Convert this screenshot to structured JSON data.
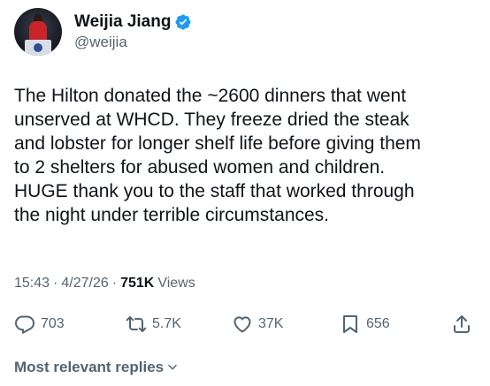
{
  "author": {
    "display_name": "Weijia Jiang",
    "handle": "@weijia",
    "verified": true,
    "verified_color": "#1d9bf0"
  },
  "tweet": {
    "text": "The Hilton donated the ~2600 dinners that went\nunserved at WHCD. They freeze dried the steak\nand lobster for longer shelf life before giving them\nto 2 shelters for abused women and children.\nHUGE thank you to the staff that worked through\nthe night under terrible circumstances."
  },
  "meta": {
    "time": "15:43",
    "date": "4/27/26",
    "separator": "·",
    "views_count": "751K",
    "views_label": "Views"
  },
  "actions": {
    "replies": {
      "icon": "reply-icon",
      "count": "703"
    },
    "reposts": {
      "icon": "repost-icon",
      "count": "5.7K"
    },
    "likes": {
      "icon": "like-icon",
      "count": "37K"
    },
    "bookmarks": {
      "icon": "bookmark-icon",
      "count": "656"
    },
    "share": {
      "icon": "share-icon"
    }
  },
  "replies_sort": {
    "label": "Most relevant replies",
    "icon": "chevron-down-icon"
  },
  "colors": {
    "text_primary": "#0f1419",
    "text_secondary": "#536471",
    "accent": "#1d9bf0"
  }
}
